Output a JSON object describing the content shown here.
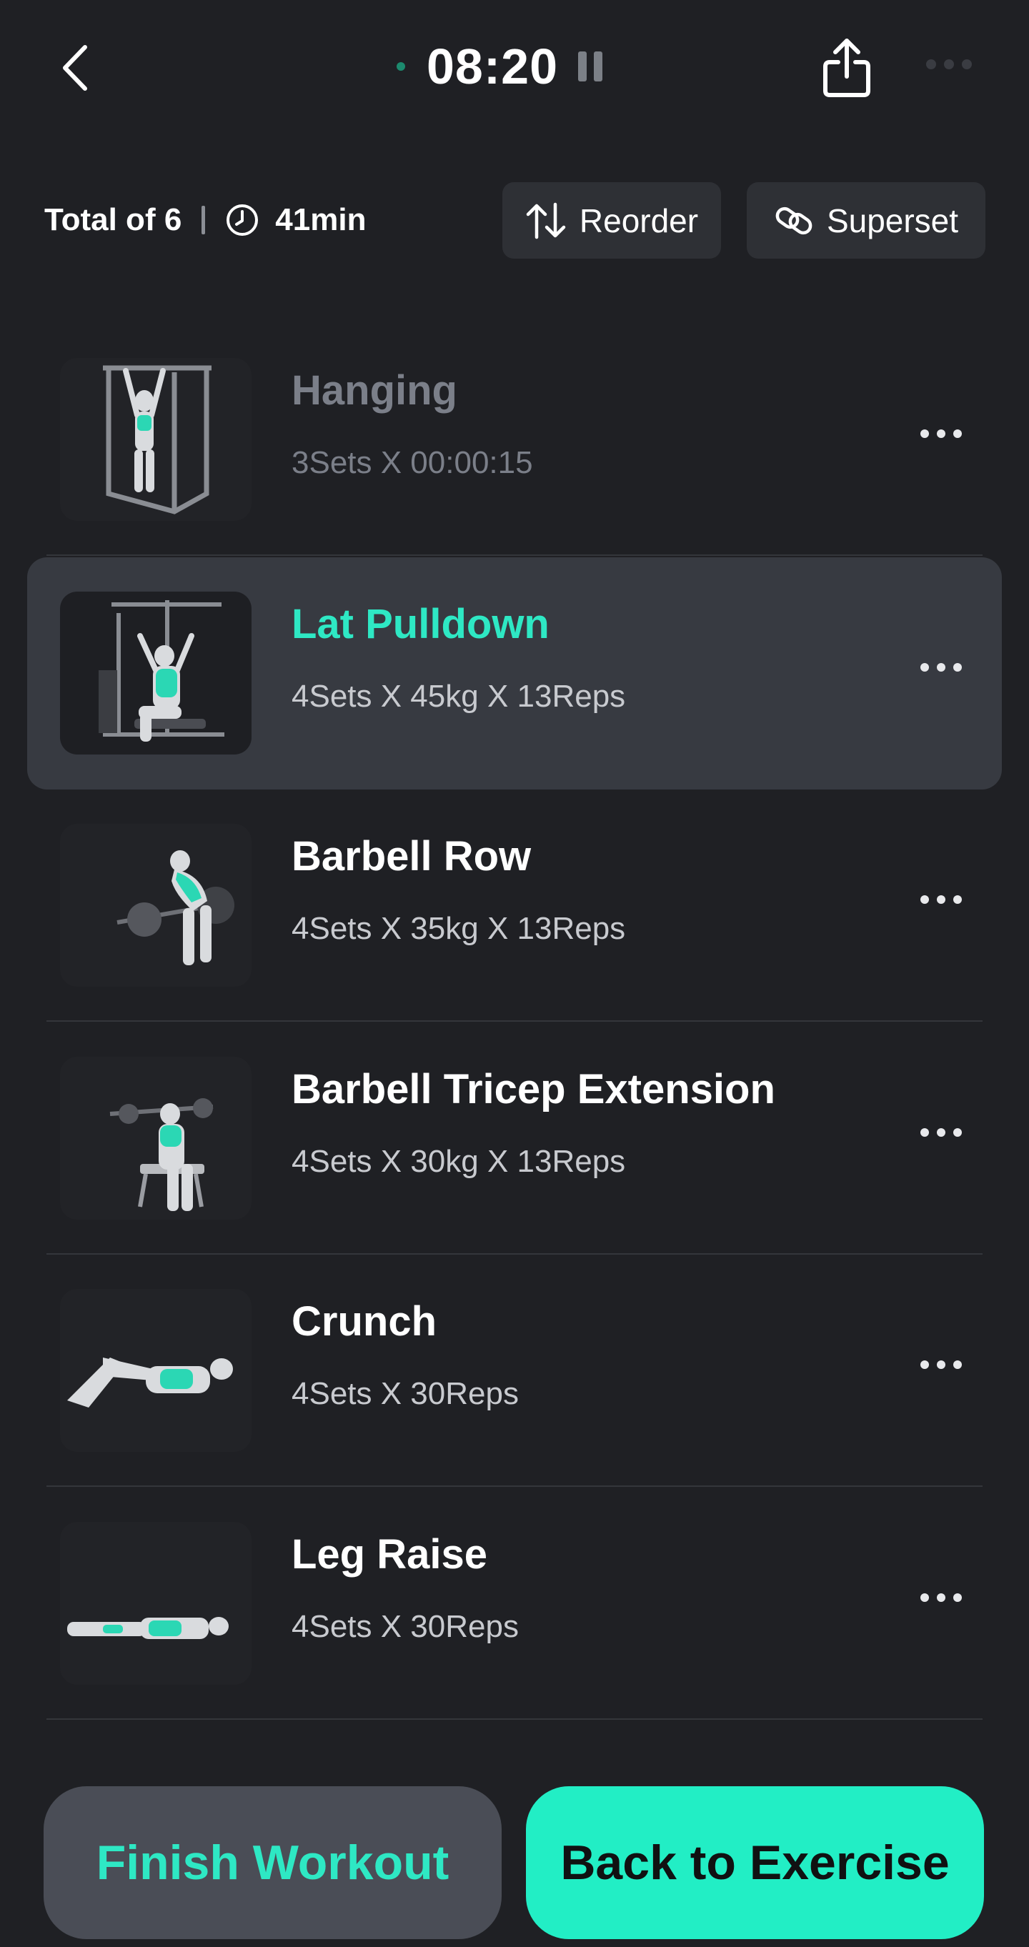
{
  "header": {
    "timer": "08:20",
    "icons": {
      "back": "chevron-left-icon",
      "share": "share-icon",
      "pause": "pause-icon",
      "more": "more-horizontal-icon"
    }
  },
  "summary": {
    "total": "Total of 6",
    "duration": "41min",
    "reorder_label": "Reorder",
    "superset_label": "Superset"
  },
  "exercises": [
    {
      "name": "Hanging",
      "detail": "3Sets X 00:00:15",
      "state": "done"
    },
    {
      "name": "Lat Pulldown",
      "detail": "4Sets X 45kg X 13Reps",
      "state": "active"
    },
    {
      "name": "Barbell Row",
      "detail": "4Sets X 35kg X 13Reps",
      "state": "pending"
    },
    {
      "name": "Barbell Tricep Extension",
      "detail": "4Sets X 30kg X 13Reps",
      "state": "pending"
    },
    {
      "name": "Crunch",
      "detail": "4Sets X 30Reps",
      "state": "pending"
    },
    {
      "name": "Leg Raise",
      "detail": "4Sets X 30Reps",
      "state": "pending"
    }
  ],
  "footer": {
    "finish_label": "Finish Workout",
    "back_label": "Back to Exercise"
  },
  "colors": {
    "background": "#1f2024",
    "accent": "#22eec5",
    "active_row": "#373a41",
    "muted_text": "#7b7f89"
  }
}
